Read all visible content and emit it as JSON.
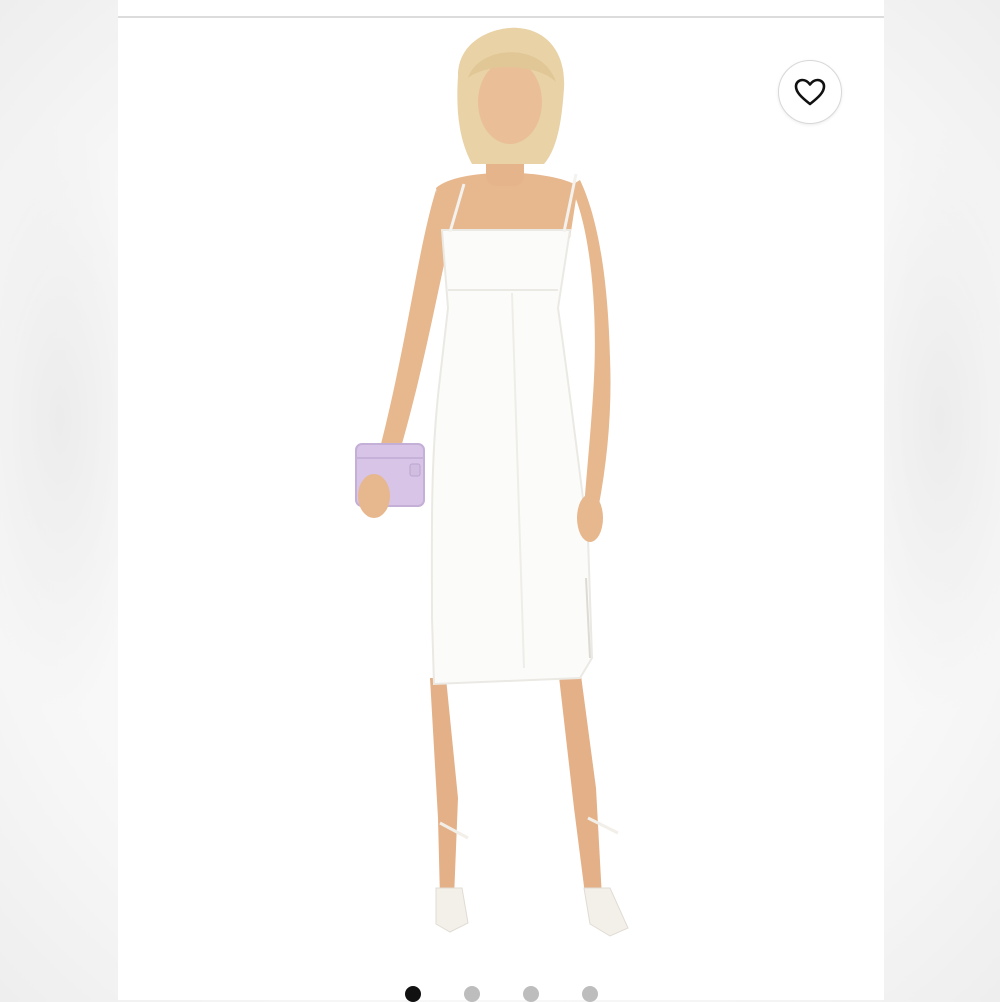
{
  "product_image": {
    "alt_text": "",
    "colors": {
      "dress": "#fbfbf9",
      "skin": "#e7b78e",
      "hair": "#e8d2a6",
      "clutch": "#d7c4e6",
      "background": "#ffffff"
    }
  },
  "wishlist": {
    "icon": "heart-outline-icon"
  },
  "carousel": {
    "total": 4,
    "active_index": 0
  }
}
